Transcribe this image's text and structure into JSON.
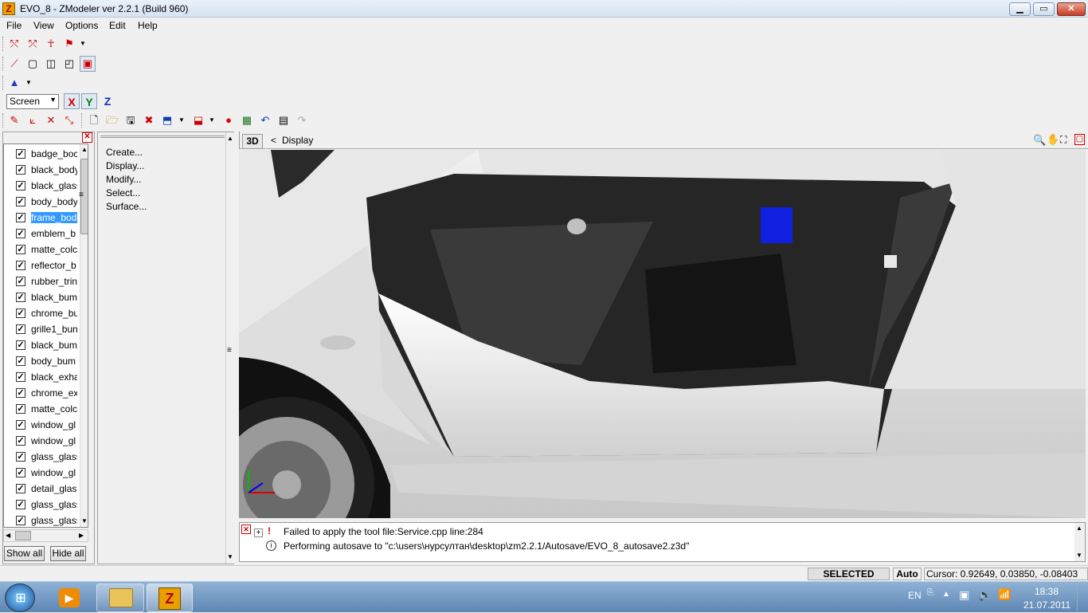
{
  "window": {
    "title": "EVO_8 - ZModeler ver 2.2.1 (Build 960)",
    "logo_letter": "Z",
    "minimize": "▁",
    "maximize": "▭",
    "close": "✕"
  },
  "menu": [
    "File",
    "View",
    "Options",
    "Edit",
    "Help"
  ],
  "toolbar": {
    "space_select": "Screen",
    "axis_x": "X",
    "axis_y": "Y",
    "axis_z": "Z"
  },
  "layers": [
    {
      "name": "badge_boc",
      "checked": "✓",
      "selected": false
    },
    {
      "name": "black_body",
      "checked": "✓",
      "selected": false
    },
    {
      "name": "black_glass",
      "checked": "✓",
      "selected": false
    },
    {
      "name": "body_body",
      "checked": "✓",
      "selected": false
    },
    {
      "name": "frame_bod",
      "checked": "✓",
      "selected": true
    },
    {
      "name": "emblem_b",
      "checked": "✓",
      "selected": false
    },
    {
      "name": "matte_colc",
      "checked": "✓",
      "selected": false
    },
    {
      "name": "reflector_b",
      "checked": "✓",
      "selected": false
    },
    {
      "name": "rubber_trin",
      "checked": "✓",
      "selected": false
    },
    {
      "name": "black_bum",
      "checked": "✓",
      "selected": false
    },
    {
      "name": "chrome_bu",
      "checked": "✓",
      "selected": false
    },
    {
      "name": "grille1_bun",
      "checked": "✓",
      "selected": false
    },
    {
      "name": "black_bum",
      "checked": "✓",
      "selected": false
    },
    {
      "name": "body_bum",
      "checked": "✓",
      "selected": false
    },
    {
      "name": "black_exha",
      "checked": "✓",
      "selected": false
    },
    {
      "name": "chrome_ex",
      "checked": "✓",
      "selected": false
    },
    {
      "name": "matte_colc",
      "checked": "✓",
      "selected": false
    },
    {
      "name": "window_gl",
      "checked": "✓",
      "selected": false
    },
    {
      "name": "window_gl",
      "checked": "✓",
      "selected": false
    },
    {
      "name": "glass_glass",
      "checked": "✓",
      "selected": false
    },
    {
      "name": "window_gl",
      "checked": "✓",
      "selected": false
    },
    {
      "name": "detail_glas",
      "checked": "✓",
      "selected": false
    },
    {
      "name": "glass_glass",
      "checked": "✓",
      "selected": false
    },
    {
      "name": "glass_glass",
      "checked": "✓",
      "selected": false
    }
  ],
  "layer_buttons": {
    "show_all": "Show all",
    "hide_all": "Hide all"
  },
  "commands": [
    "Create...",
    "Display...",
    "Modify...",
    "Select...",
    "Surface..."
  ],
  "viewport": {
    "mode": "3D",
    "back": "<",
    "breadcrumb": "Display"
  },
  "log": [
    {
      "icon": "!",
      "text": "Failed to apply the tool file:Service.cpp line:284"
    },
    {
      "icon": "i",
      "text": "Performing autosave to \"c:\\users\\нурсултан\\desktop\\zm2.2.1/Autosave/EVO_8_autosave2.z3d\""
    }
  ],
  "status": {
    "mode": "SELECTED MODE",
    "auto": "Auto",
    "cursor": "Cursor: 0.92649, 0.03850, -0.08403"
  },
  "taskbar": {
    "lang": "EN",
    "time": "18:38",
    "date": "21.07.2011",
    "zm_letter": "Z"
  }
}
